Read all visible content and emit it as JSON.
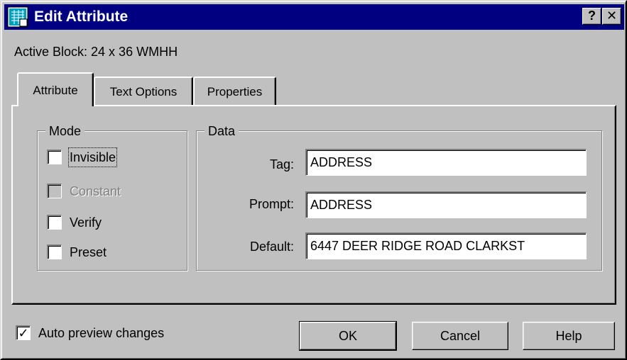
{
  "window": {
    "title": "Edit Attribute"
  },
  "titlebar": {
    "help_label": "?",
    "close_label": "✕"
  },
  "active_block": "Active Block: 24 x 36 WMHH",
  "tabs": [
    {
      "label": "Attribute",
      "selected": true
    },
    {
      "label": "Text Options",
      "selected": false
    },
    {
      "label": "Properties",
      "selected": false
    }
  ],
  "mode": {
    "legend": "Mode",
    "items": [
      {
        "label": "Invisible",
        "checked": false,
        "enabled": true
      },
      {
        "label": "Constant",
        "checked": false,
        "enabled": false
      },
      {
        "label": "Verify",
        "checked": false,
        "enabled": true
      },
      {
        "label": "Preset",
        "checked": false,
        "enabled": true
      }
    ]
  },
  "data_group": {
    "legend": "Data",
    "tag": {
      "label": "Tag:",
      "value": "ADDRESS"
    },
    "prompt": {
      "label": "Prompt:",
      "value": "ADDRESS"
    },
    "default": {
      "label": "Default:",
      "value": "6447 DEER RIDGE ROAD   CLARKST"
    }
  },
  "auto_preview": {
    "label": "Auto preview changes",
    "checked": true,
    "mark": "✓"
  },
  "buttons": {
    "ok": "OK",
    "cancel": "Cancel",
    "help": "Help"
  },
  "colors": {
    "titlebar": "#000080",
    "face": "#c0c0c0"
  }
}
